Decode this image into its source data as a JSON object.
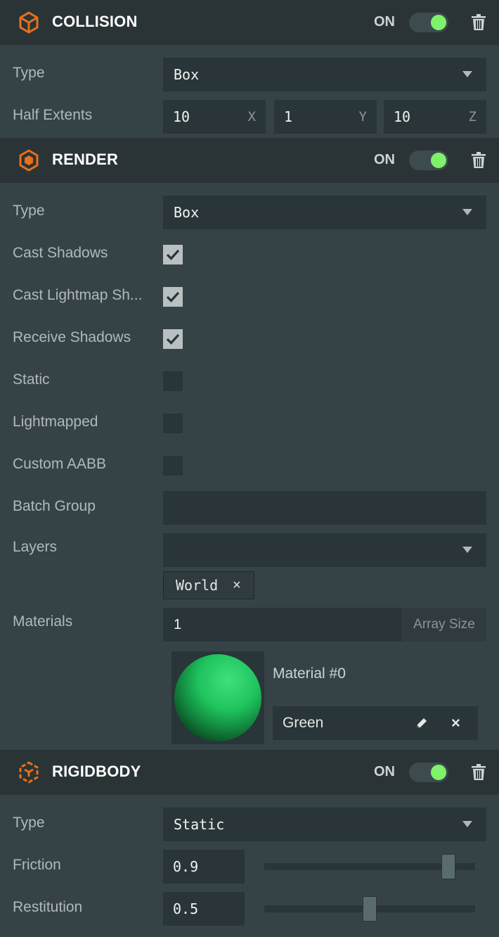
{
  "collision": {
    "title": "COLLISION",
    "on_label": "ON",
    "enabled": true,
    "type_label": "Type",
    "type_value": "Box",
    "half_extents_label": "Half Extents",
    "half_extents": [
      {
        "value": "10",
        "axis": "X"
      },
      {
        "value": "1",
        "axis": "Y"
      },
      {
        "value": "10",
        "axis": "Z"
      }
    ]
  },
  "render": {
    "title": "RENDER",
    "on_label": "ON",
    "enabled": true,
    "type_label": "Type",
    "type_value": "Box",
    "cast_shadows_label": "Cast Shadows",
    "cast_shadows": true,
    "cast_lightmap_label": "Cast Lightmap Sh...",
    "cast_lightmap": true,
    "receive_shadows_label": "Receive Shadows",
    "receive_shadows": true,
    "static_label": "Static",
    "static": false,
    "lightmapped_label": "Lightmapped",
    "lightmapped": false,
    "custom_aabb_label": "Custom AABB",
    "custom_aabb": false,
    "batch_group_label": "Batch Group",
    "batch_group_value": "",
    "layers_label": "Layers",
    "layers_value": "",
    "layer_tags": [
      "World"
    ],
    "tag_remove": "×",
    "materials_label": "Materials",
    "materials_count": "1",
    "array_size_label": "Array Size",
    "material_slot_title": "Material #0",
    "material_name": "Green",
    "material_remove": "×"
  },
  "rigidbody": {
    "title": "RIGIDBODY",
    "on_label": "ON",
    "enabled": true,
    "type_label": "Type",
    "type_value": "Static",
    "friction_label": "Friction",
    "friction_value": "0.9",
    "friction_fraction": 0.9,
    "restitution_label": "Restitution",
    "restitution_value": "0.5",
    "restitution_fraction": 0.5
  },
  "colors": {
    "accent": "#e8701a",
    "toggle_on": "#7ff26c",
    "header_bg": "#2a3436",
    "panel_bg": "#364346",
    "field_bg": "#293538"
  },
  "icons": {
    "collision": "cube-outline-icon",
    "render": "hexagon-icon",
    "rigidbody": "rigidbody-cube-icon",
    "delete": "trash-icon",
    "edit": "pencil-icon",
    "check": "checkmark-icon",
    "dropdown": "caret-down-icon"
  }
}
